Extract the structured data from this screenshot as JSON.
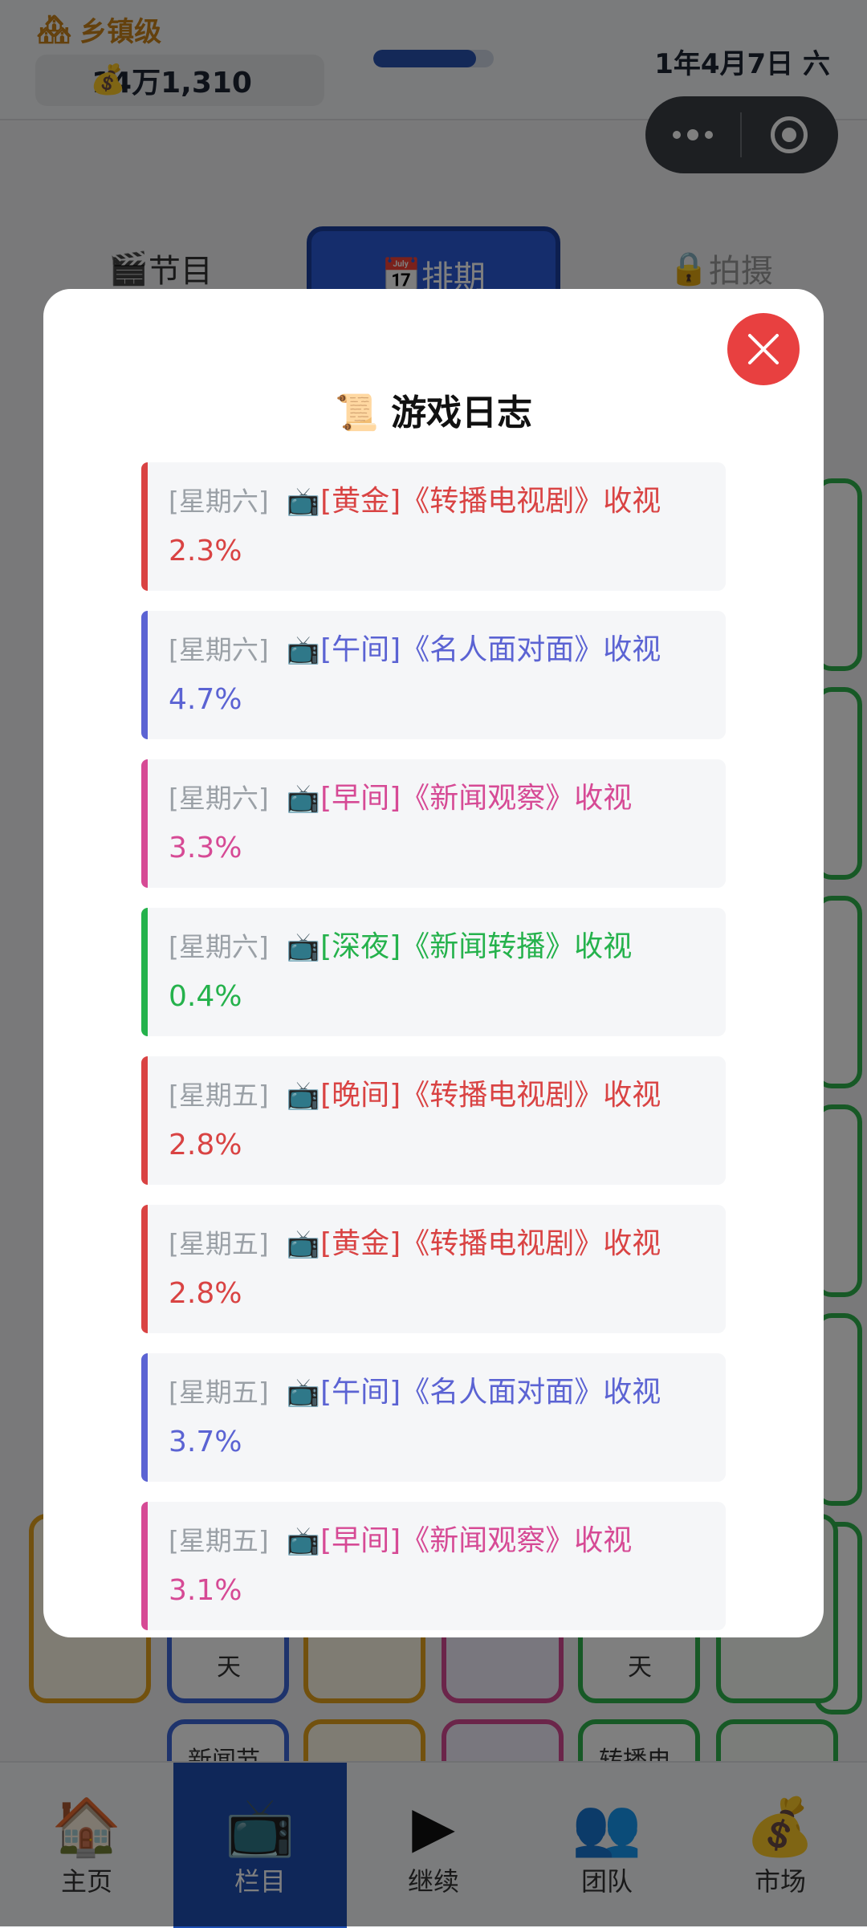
{
  "status": {
    "level_icon": "house-icon",
    "level_text": "乡镇级",
    "money_icon": "money-bag-icon",
    "money": "14万1,310",
    "date": "1年4月7日 六",
    "progress": 0.85
  },
  "tabs": [
    {
      "icon": "🎬",
      "label": "节目"
    },
    {
      "icon": "📅",
      "label": "排期"
    },
    {
      "icon": "🔒",
      "label": "拍摄"
    }
  ],
  "background_cells": [
    {
      "label": "新闻节"
    },
    {
      "label": "转播电"
    },
    {
      "label": "天"
    },
    {
      "label": "天"
    }
  ],
  "modal": {
    "title_icon": "📜",
    "title": "游戏日志",
    "close_icon": "close-icon",
    "entries": [
      {
        "day": "[星期六]",
        "icon": "📺",
        "slot": "[黄金]",
        "program": "《转播电视剧》收视",
        "rating": "2.3%",
        "color": "#d94343"
      },
      {
        "day": "[星期六]",
        "icon": "📺",
        "slot": "[午间]",
        "program": "《名人面对面》收视",
        "rating": "4.7%",
        "color": "#5b63d3"
      },
      {
        "day": "[星期六]",
        "icon": "📺",
        "slot": "[早间]",
        "program": "《新闻观察》收视",
        "rating": "3.3%",
        "color": "#d64a95"
      },
      {
        "day": "[星期六]",
        "icon": "📺",
        "slot": "[深夜]",
        "program": "《新闻转播》收视",
        "rating": "0.4%",
        "color": "#25b24c"
      },
      {
        "day": "[星期五]",
        "icon": "📺",
        "slot": "[晚间]",
        "program": "《转播电视剧》收视",
        "rating": "2.8%",
        "color": "#d94343"
      },
      {
        "day": "[星期五]",
        "icon": "📺",
        "slot": "[黄金]",
        "program": "《转播电视剧》收视",
        "rating": "2.8%",
        "color": "#d94343"
      },
      {
        "day": "[星期五]",
        "icon": "📺",
        "slot": "[午间]",
        "program": "《名人面对面》收视",
        "rating": "3.7%",
        "color": "#5b63d3"
      },
      {
        "day": "[星期五]",
        "icon": "📺",
        "slot": "[早间]",
        "program": "《新闻观察》收视",
        "rating": "3.1%",
        "color": "#d64a95"
      }
    ]
  },
  "bottom_nav": [
    {
      "icon": "🏠",
      "label": "主页",
      "active": false
    },
    {
      "icon": "📺",
      "label": "栏目",
      "active": true
    },
    {
      "icon": "▶",
      "label": "继续",
      "active": false
    },
    {
      "icon": "👥",
      "label": "团队",
      "active": false
    },
    {
      "icon": "💰",
      "label": "市场",
      "active": false
    }
  ]
}
